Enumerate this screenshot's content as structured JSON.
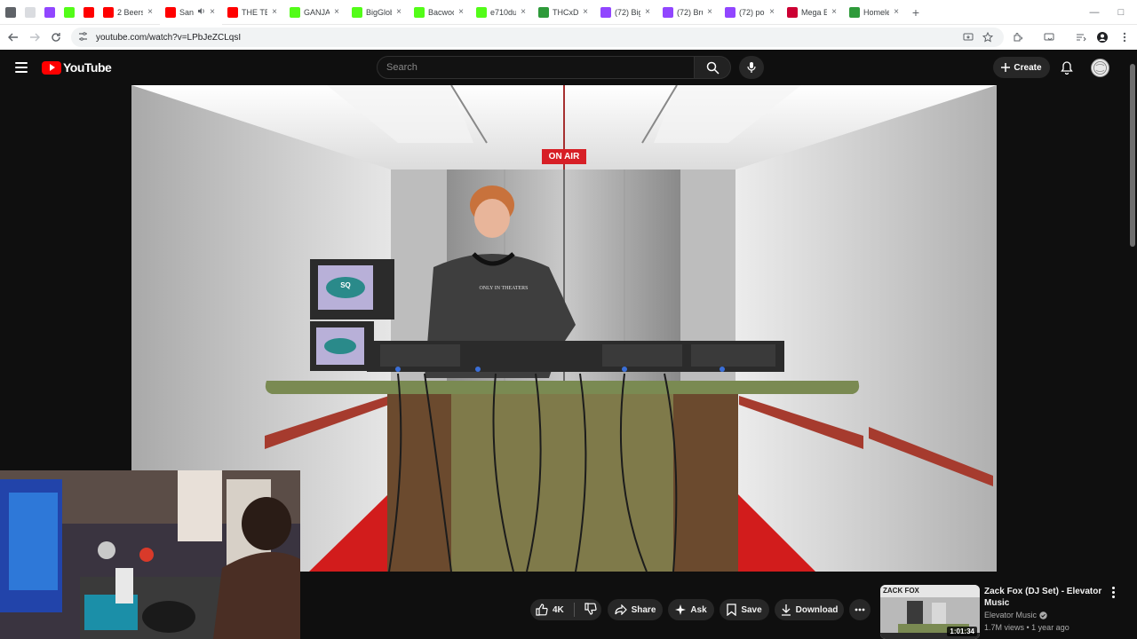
{
  "browser": {
    "tabs": [
      {
        "title": "",
        "icon": "gear-icon",
        "color": "#5f6368"
      },
      {
        "title": "",
        "icon": "blank-icon",
        "color": "#dadce0"
      },
      {
        "title": "",
        "icon": "twitch-icon",
        "color": "#9146ff"
      },
      {
        "title": "",
        "icon": "kick-icon",
        "color": "#53fc18"
      },
      {
        "title": "",
        "icon": "youtube-icon",
        "color": "#ff0000"
      },
      {
        "title": "2 Beers",
        "icon": "youtube-icon",
        "color": "#ff0000"
      },
      {
        "title": "San",
        "icon": "youtube-icon",
        "color": "#ff0000",
        "active": true,
        "audio": true
      },
      {
        "title": "THE TEI",
        "icon": "youtube-icon",
        "color": "#ff0000"
      },
      {
        "title": "GANJA",
        "icon": "kick-icon",
        "color": "#53fc18"
      },
      {
        "title": "BigGlob",
        "icon": "kick-icon",
        "color": "#53fc18"
      },
      {
        "title": "Bacwoo",
        "icon": "kick-icon",
        "color": "#53fc18"
      },
      {
        "title": "e710du",
        "icon": "kick-icon",
        "color": "#53fc18"
      },
      {
        "title": "THCxDu",
        "icon": "kick-green-icon",
        "color": "#2e9a3a"
      },
      {
        "title": "(72) Big",
        "icon": "twitch-icon",
        "color": "#9146ff"
      },
      {
        "title": "(72) Bru",
        "icon": "twitch-icon",
        "color": "#9146ff"
      },
      {
        "title": "(72) po",
        "icon": "twitch-icon",
        "color": "#9146ff"
      },
      {
        "title": "Mega E",
        "icon": "record-icon",
        "color": "#cc0033"
      },
      {
        "title": "Homele",
        "icon": "kick-green-icon",
        "color": "#2e9a3a"
      }
    ],
    "new_tab_label": "+",
    "url": "youtube.com/watch?v=LPbJeZCLqsI"
  },
  "youtube": {
    "logo_text": "YouTube",
    "search_placeholder": "Search",
    "create_label": "Create"
  },
  "video": {
    "on_air_sign": "ON AIR",
    "shirt_text": "ONLY IN THEATERS",
    "tv_label": "SQ"
  },
  "actions": {
    "like_count": "4K",
    "share_label": "Share",
    "ask_label": "Ask",
    "save_label": "Save",
    "download_label": "Download"
  },
  "up_next": {
    "title": "Zack Fox (DJ Set) - Elevator Music",
    "channel": "Elevator Music",
    "views": "1.7M views",
    "age": "1 year ago",
    "meta_sep": " • ",
    "duration": "1:01:34",
    "thumb_text": "ZACK FOX"
  }
}
